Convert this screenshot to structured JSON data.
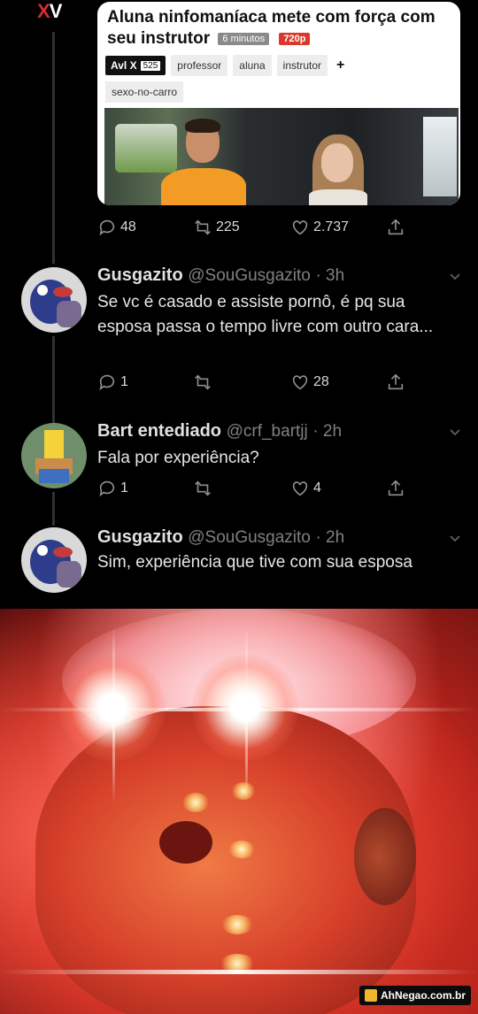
{
  "embed": {
    "logo": "XV",
    "title": "Aluna ninfomaníaca mete com força com seu instrutor",
    "duration": "6 minutos",
    "quality": "720p",
    "channel": "Avl X",
    "channel_count": "525",
    "tags": [
      "professor",
      "aluna",
      "instrutor",
      "sexo-no-carro"
    ],
    "plus": "+"
  },
  "tweets": [
    {
      "name": "Gusgazito",
      "handle": "@SouGusgazito",
      "time": "· 3h",
      "text": "Se vc é casado e assiste pornô, é pq sua esposa passa o tempo livre com outro cara...",
      "replies": "1",
      "retweets": "",
      "likes": "28"
    },
    {
      "name": "Bart entediado",
      "handle": "@crf_bartjj",
      "time": "· 2h",
      "text": "Fala por experiência?",
      "replies": "1",
      "retweets": "",
      "likes": "4"
    },
    {
      "name": "Gusgazito",
      "handle": "@SouGusgazito",
      "time": "· 2h",
      "text": "Sim, experiência que tive com sua esposa"
    }
  ],
  "top_actions": {
    "replies": "48",
    "retweets": "225",
    "likes": "2.737"
  },
  "watermark": "AhNegao.com.br",
  "colors": {
    "background": "#000000",
    "text": "#e6e6e6",
    "muted": "#7d8185",
    "badge_red": "#d9382b"
  }
}
